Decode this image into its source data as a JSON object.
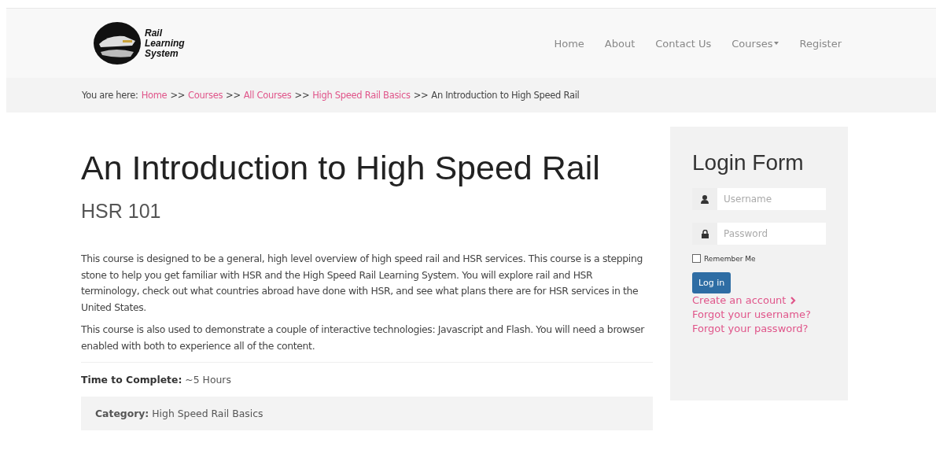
{
  "header": {
    "logo_text": [
      "Rail",
      "Learning",
      "System"
    ],
    "nav": [
      {
        "label": "Home",
        "dropdown": false
      },
      {
        "label": "About",
        "dropdown": false
      },
      {
        "label": "Contact Us",
        "dropdown": false
      },
      {
        "label": "Courses",
        "dropdown": true
      },
      {
        "label": "Register",
        "dropdown": false
      }
    ]
  },
  "breadcrumb": {
    "label": "You are here:",
    "items": [
      {
        "kind": "link",
        "text": "Home"
      },
      {
        "kind": "sep",
        "text": ">>"
      },
      {
        "kind": "link",
        "text": "Courses"
      },
      {
        "kind": "sep",
        "text": ">>"
      },
      {
        "kind": "link",
        "text": "All Courses"
      },
      {
        "kind": "sep",
        "text": ">>"
      },
      {
        "kind": "link",
        "text": "High Speed Rail Basics"
      },
      {
        "kind": "sep",
        "text": ">>"
      },
      {
        "kind": "current",
        "text": "An Introduction to High Speed Rail"
      }
    ]
  },
  "course": {
    "title": "An Introduction to High Speed Rail",
    "code": "HSR 101",
    "paragraphs": [
      "This course is designed to be a general, high level overview of high speed rail and HSR services. This course is a stepping stone to help you get familiar with HSR and the High Speed Rail Learning System. You will explore rail and HSR terminology, check out what countries abroad have done with HSR, and see what plans there are for HSR services in the United States.",
      "This course is also used to demonstrate a couple of interactive technologies: Javascript and Flash. You will need a browser enabled with both to experience all of the content."
    ],
    "time": {
      "label": "Time to Complete:",
      "value": "~5 Hours"
    },
    "category": {
      "label": "Category:",
      "value": "High Speed Rail Basics"
    }
  },
  "login": {
    "title": "Login Form",
    "username": {
      "placeholder": "Username"
    },
    "password": {
      "placeholder": "Password"
    },
    "remember": {
      "label": "Remember Me",
      "checked": false
    },
    "button": "Log in",
    "links": [
      {
        "text": "Create an account",
        "arrow": true
      },
      {
        "text": "Forgot your username?",
        "arrow": false
      },
      {
        "text": "Forgot your password?",
        "arrow": false
      }
    ]
  }
}
